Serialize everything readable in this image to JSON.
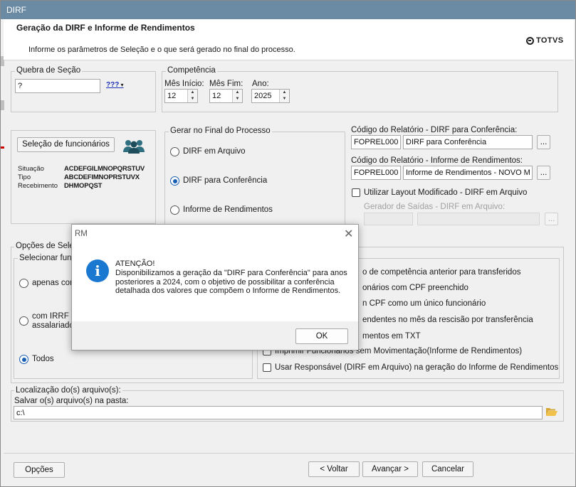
{
  "window": {
    "title": "DIRF"
  },
  "header": {
    "title": "Geração da DIRF e Informe de Rendimentos",
    "description": "Informe os parâmetros de Seleção e o que será gerado no final do processo.",
    "brand": "TOTVS"
  },
  "quebra": {
    "legend": "Quebra de Seção",
    "value": "?",
    "picker_label": "???"
  },
  "competencia": {
    "legend": "Competência",
    "mes_inicio_label": "Mês Início:",
    "mes_inicio": "12",
    "mes_fim_label": "Mês Fim:",
    "mes_fim": "12",
    "ano_label": "Ano:",
    "ano": "2025"
  },
  "funcionarios": {
    "button": "Seleção de funcionários",
    "rows": [
      {
        "label": "Situação",
        "value": "ACDEFGILMNOPQRSTUV"
      },
      {
        "label": "Tipo",
        "value": "ABCDEFIMNOPRSTUVX"
      },
      {
        "label": "Recebimento",
        "value": "DHMOPQST"
      }
    ]
  },
  "gerar": {
    "legend": "Gerar no Final do Processo",
    "options": [
      "DIRF em Arquivo",
      "DIRF para Conferência",
      "Informe de Rendimentos"
    ],
    "selected": "DIRF para Conferência"
  },
  "relatorios": {
    "conferencia_label": "Código do Relatório - DIRF para Conferência:",
    "conferencia_code": "FOPREL0007",
    "conferencia_name": "DIRF para Conferência",
    "informe_label": "Código do Relatório - Informe de Rendimentos:",
    "informe_code": "FOPREL0008.",
    "informe_name": "Informe de Rendimentos - NOVO MO",
    "browse": "...",
    "layout_label": "Utilizar Layout Modificado - DIRF em Arquivo",
    "gerador_label": "Gerador de Saídas - DIRF em Arquivo:"
  },
  "opcoes": {
    "legend": "Opções de Seleç",
    "selecionar_legend": "Selecionar funci",
    "radios": [
      "apenas com",
      "com IRRF o",
      "assalariado",
      "Todos"
    ],
    "selected": "Todos",
    "checks": [
      "o de competência anterior para transferidos",
      "onários com CPF preenchido",
      "n CPF como um único funcionário",
      "endentes no mês da rescisão por transferência",
      "mentos em TXT",
      "Imprimir Funcionários sem Movimentação(Informe de Rendimentos)",
      "Usar Responsável (DIRF em Arquivo) na geração do Informe de Rendimentos"
    ]
  },
  "localizacao": {
    "legend": "Localização do(s) arquivo(s):",
    "pasta_label": "Salvar o(s) arquivo(s) na pasta:",
    "pasta_value": "c:\\"
  },
  "footer": {
    "options": "Opções",
    "back": "< Voltar",
    "next": "Avançar >",
    "cancel": "Cancelar"
  },
  "dialog": {
    "title": "RM",
    "close": "✕",
    "icon": "i",
    "heading": "ATENÇÃO!",
    "message": "Disponibilizamos a geração da \"DIRF para Conferência\" para anos posteriores a 2024, com o objetivo de possibilitar a conferência detalhada dos valores que compõem o Informe de Rendimentos.",
    "ok": "OK"
  },
  "colors": {
    "accent": "#1a5fb4",
    "link": "#1a2fb5",
    "info": "#1b78d0",
    "titlebar": "#6b8aa3"
  }
}
